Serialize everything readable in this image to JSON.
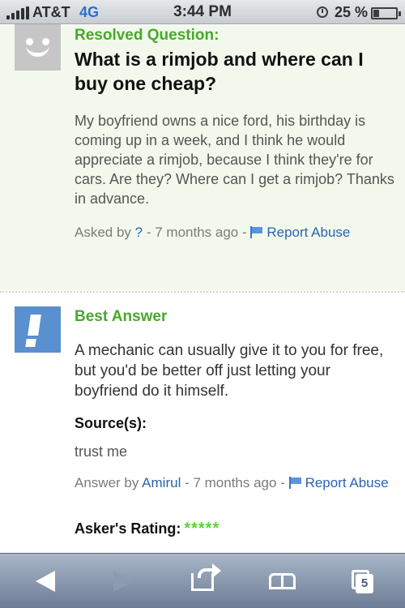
{
  "status_bar": {
    "carrier": "AT&T",
    "network": "4G",
    "time": "3:44 PM",
    "battery_percent": "25 %",
    "battery_level": 0.25
  },
  "question": {
    "label": "Resolved Question:",
    "title": "What is a rimjob and where can I buy one cheap?",
    "body": "My boyfriend owns a nice ford, his birthday is coming up in a week, and I think he would appreciate a rimjob, because I think they're for cars. Are they? Where can I get a rimjob? Thanks in advance.",
    "asked_by_prefix": "Asked by",
    "asker": "?",
    "time_ago": "7 months ago",
    "report_abuse": "Report Abuse"
  },
  "answer": {
    "label": "Best Answer",
    "body": "A mechanic can usually give it to you for free, but you'd be better off just letting your boyfriend do it himself.",
    "sources_label": "Source(s):",
    "sources_text": "trust me",
    "answer_by_prefix": "Answer by",
    "answerer": "Amirul",
    "time_ago": "7 months ago",
    "report_abuse": "Report Abuse",
    "rating_label": "Asker's Rating:",
    "rating_stars": "*****",
    "rating_value": 5
  },
  "toolbar": {
    "tab_count": "5"
  },
  "colors": {
    "accent_green": "#48a82c",
    "link_blue": "#2a64b0",
    "star_green": "#5fd23a"
  }
}
